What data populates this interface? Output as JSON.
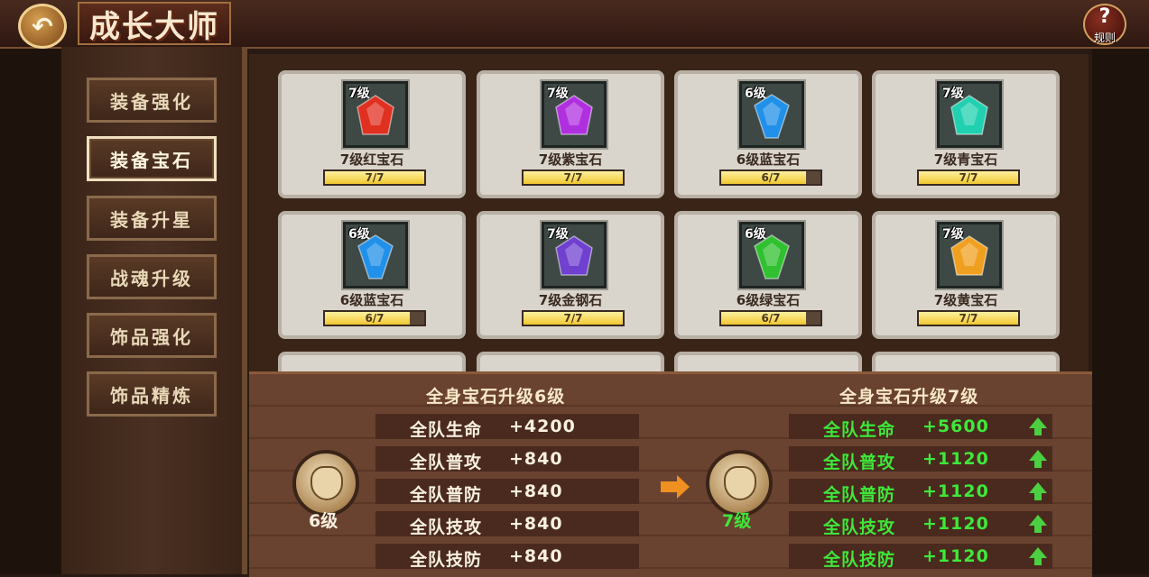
{
  "header": {
    "title": "成长大师",
    "back_icon": "↶",
    "rules_label": "规则",
    "rules_icon": "?"
  },
  "sidebar": {
    "tabs": [
      {
        "label": "装备强化",
        "active": false
      },
      {
        "label": "装备宝石",
        "active": true
      },
      {
        "label": "装备升星",
        "active": false
      },
      {
        "label": "战魂升级",
        "active": false
      },
      {
        "label": "饰品强化",
        "active": false
      },
      {
        "label": "饰品精炼",
        "active": false
      }
    ]
  },
  "gems": [
    {
      "level": "7级",
      "name": "7级红宝石",
      "progress": "7/7",
      "fill": 1.0,
      "color": "#e03020",
      "shape": "pentagon"
    },
    {
      "level": "7级",
      "name": "7级紫宝石",
      "progress": "7/7",
      "fill": 1.0,
      "color": "#b030e0",
      "shape": "pentagon"
    },
    {
      "level": "6级",
      "name": "6级蓝宝石",
      "progress": "6/7",
      "fill": 0.857,
      "color": "#2090e8",
      "shape": "diamond"
    },
    {
      "level": "7级",
      "name": "7级青宝石",
      "progress": "7/7",
      "fill": 1.0,
      "color": "#20d0b0",
      "shape": "pentagon"
    },
    {
      "level": "6级",
      "name": "6级蓝宝石",
      "progress": "6/7",
      "fill": 0.857,
      "color": "#2090e8",
      "shape": "diamond"
    },
    {
      "level": "7级",
      "name": "7级金钢石",
      "progress": "7/7",
      "fill": 1.0,
      "color": "#7040d0",
      "shape": "pentagon"
    },
    {
      "level": "6级",
      "name": "6级绿宝石",
      "progress": "6/7",
      "fill": 0.857,
      "color": "#30c030",
      "shape": "diamond"
    },
    {
      "level": "7级",
      "name": "7级黄宝石",
      "progress": "7/7",
      "fill": 1.0,
      "color": "#f0a020",
      "shape": "pentagon"
    }
  ],
  "current": {
    "title": "全身宝石升级6级",
    "level": "6级",
    "stats": [
      {
        "label": "全队生命",
        "value": "+4200"
      },
      {
        "label": "全队普攻",
        "value": "+840"
      },
      {
        "label": "全队普防",
        "value": "+840"
      },
      {
        "label": "全队技攻",
        "value": "+840"
      },
      {
        "label": "全队技防",
        "value": "+840"
      }
    ]
  },
  "next": {
    "title": "全身宝石升级7级",
    "level": "7级",
    "stats": [
      {
        "label": "全队生命",
        "value": "+5600"
      },
      {
        "label": "全队普攻",
        "value": "+1120"
      },
      {
        "label": "全队普防",
        "value": "+1120"
      },
      {
        "label": "全队技攻",
        "value": "+1120"
      },
      {
        "label": "全队技防",
        "value": "+1120"
      }
    ]
  },
  "colors": {
    "green_text": "#3ee83a",
    "level_next": "#3ee83a",
    "arrow": "#f09020"
  }
}
